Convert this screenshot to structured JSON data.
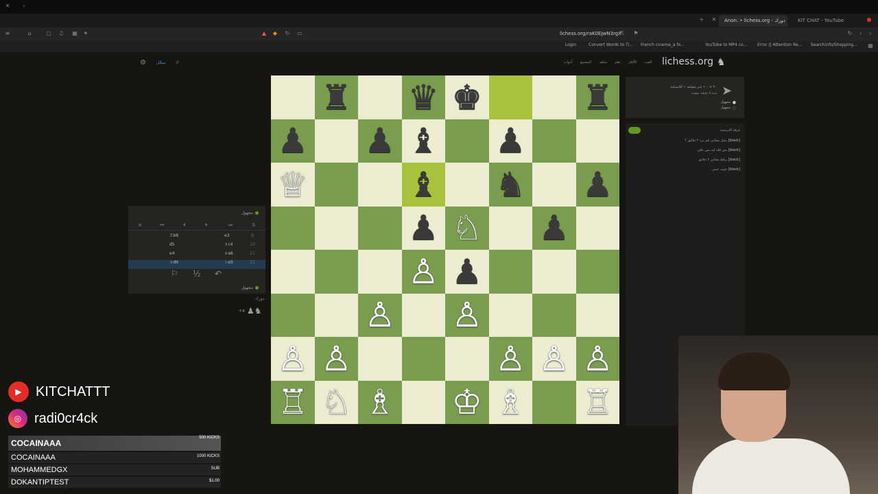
{
  "browser": {
    "tabs": [
      {
        "label": "Anon. • lichess.org - ﺍﻟﻌﺐ • ﺩﻭﺭﻙ",
        "active": true
      },
      {
        "label": "KIT CHAT - YouTube",
        "active": false
      }
    ],
    "url": "lichess.org/raK0EJwN3rgX",
    "bookmarks": [
      "Login",
      "Convert Words to Ti...",
      "French cinema_a fo...",
      "YouTube to MP4 co...",
      "Error || Attention Re...",
      "Searchinfo/Shopping..."
    ]
  },
  "site": {
    "logo": "lichess.org",
    "nav": [
      "ﺍﻟﻌﺐ",
      "ﺍﻷﻟﻐﺎﺯ",
      "ﺗﻌﻠﻢ",
      "ﺷﺎﻫﺪ",
      "ﺍﻟﻤﺠﺘﻤﻊ",
      "ﺃﺩﻭﺍﺕ"
    ],
    "signin": "ﺳﺠّﻞ"
  },
  "board": {
    "pieces": [
      [
        "",
        "♜",
        "",
        "♛",
        "♚",
        "",
        "",
        "♜"
      ],
      [
        "♟",
        "",
        "♟",
        "♝",
        "",
        "♟",
        "",
        ""
      ],
      [
        "♕",
        "",
        "",
        "♝",
        "",
        "♞",
        "",
        "♟"
      ],
      [
        "",
        "",
        "",
        "♟",
        "♘",
        "",
        "♟",
        ""
      ],
      [
        "",
        "",
        "",
        "♙",
        "♟",
        "",
        "",
        ""
      ],
      [
        "",
        "",
        "♙",
        "",
        "♙",
        "",
        "",
        ""
      ],
      [
        "♙",
        "♙",
        "",
        "",
        "",
        "♙",
        "♙",
        "♙"
      ],
      [
        "♖",
        "♘",
        "♗",
        "",
        "♔",
        "♗",
        "",
        "♖"
      ]
    ],
    "colors": [
      [
        "w",
        "b",
        "",
        "b",
        "b",
        "",
        "",
        "b"
      ],
      [
        "b",
        "",
        "b",
        "b",
        "",
        "b",
        "",
        ""
      ],
      [
        "w",
        "",
        "",
        "b",
        "",
        "b",
        "",
        "b"
      ],
      [
        "",
        "",
        "",
        "b",
        "w",
        "",
        "b",
        ""
      ],
      [
        "",
        "",
        "",
        "w",
        "b",
        "",
        "",
        ""
      ],
      [
        "",
        "",
        "w",
        "",
        "w",
        "",
        "",
        ""
      ],
      [
        "w",
        "w",
        "",
        "",
        "",
        "w",
        "w",
        "w"
      ],
      [
        "w",
        "w",
        "w",
        "",
        "w",
        "w",
        "",
        "w"
      ]
    ],
    "highlights": [
      "f8",
      "d6"
    ]
  },
  "movelist": {
    "top_player": "ﻣﺠﻬﻮﻝ",
    "bottom_player": "ﻣﺠﻬﻮﻝ",
    "moves": [
      {
        "num": "9",
        "white": "e3",
        "black": "♖b8"
      },
      {
        "num": "10",
        "white": "♗c4",
        "black": "d5"
      },
      {
        "num": "11",
        "white": "♕a6",
        "black": "e4"
      },
      {
        "num": "12",
        "white": "♘e5",
        "black": "♗d6",
        "active": true
      }
    ],
    "turn_label": "ﺩﻭﺭﻙ",
    "material": "+4"
  },
  "gameinfo": {
    "line1": "٣٠ + ٠ • ﻏﻴﺮ ﻣﺼﻨّﻔﺔ • ﻛﻼﺳﻴﻜﻴﺔ",
    "line2": "ﻣﻨﺬ ٥ ﺩﻗﻴﻘﺔ ﻣﻀﺖ",
    "player1": "ﻣﺠﻬﻮﻝ",
    "player2": "ﻣﺠﻬﻮﻝ"
  },
  "chat": {
    "title": "ﻏﺮﻓﺔ ﺍﻟﺪﺭﺩﺷﺔ",
    "lines": [
      {
        "user": "[black]",
        "text": "ﺑﻤﺜﻞ ﻣﺤﺎﺗﻲ ﺗﻠﻢ ﺗﺮﺩ ٢ ﺩﻗﺎﻳﻖ ؟"
      },
      {
        "user": "[black]",
        "text": "ﺑﺲ ﻗﻠﺪ ﻟﻴﻪ ﺑﺲ ﺑﺎﻗﻲ"
      },
      {
        "user": "[black]",
        "text": "ﺭﺑﺎﻁ ﻣﺤﺎﺗﻲ ٢ ﺩﻗﺎﻳﻖ"
      },
      {
        "user": "[black]",
        "text": "ﺧﻮﺏ ﺣﻴﻨﻲ"
      }
    ]
  },
  "overlay": {
    "youtube": "KITCHATTT",
    "instagram": "radi0cr4ck",
    "donations": [
      {
        "name": "COCAINAAA",
        "amount": "500 KICKS"
      },
      {
        "name": "COCAINAAA",
        "amount": "1000 KICKS"
      },
      {
        "name": "MOHAMMEDGX",
        "amount": "SUB"
      },
      {
        "name": "DOKANTIPTEST",
        "amount": "$1.00"
      }
    ]
  },
  "colors": {
    "light_square": "#ebecd0",
    "dark_square": "#799c4e",
    "highlight": "#a9c23d"
  }
}
